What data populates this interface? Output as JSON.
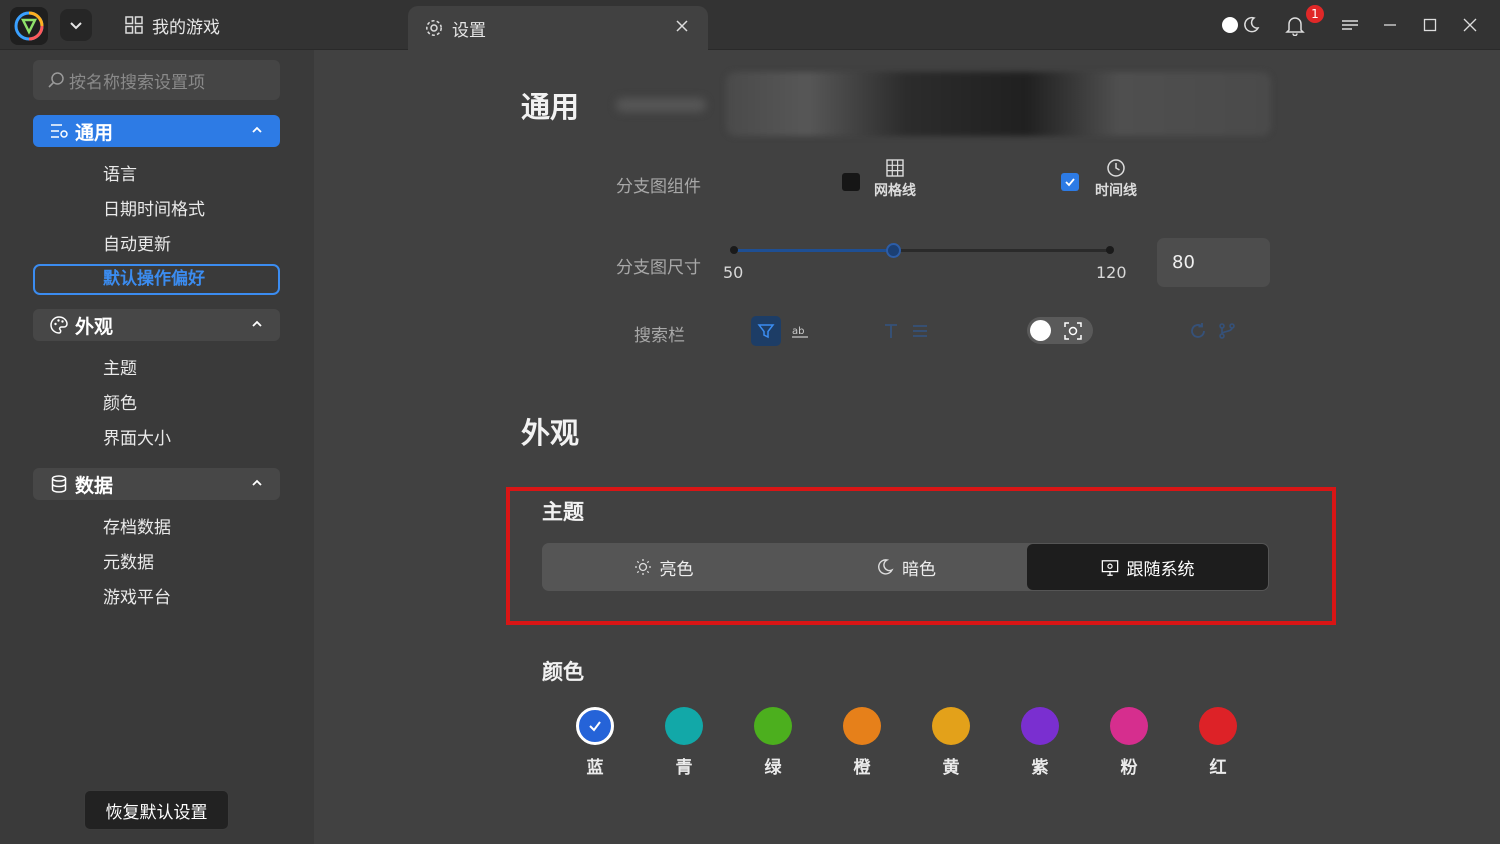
{
  "titlebar": {
    "tab_games": "我的游戏",
    "tab_settings": "设置",
    "notification_count": "1"
  },
  "sidebar": {
    "search_placeholder": "按名称搜索设置项",
    "groups": [
      {
        "label": "通用",
        "icon": "general-settings-icon",
        "items": [
          "语言",
          "日期时间格式",
          "自动更新",
          "默认操作偏好"
        ]
      },
      {
        "label": "外观",
        "icon": "palette-icon",
        "items": [
          "主题",
          "颜色",
          "界面大小"
        ]
      },
      {
        "label": "数据",
        "icon": "database-icon",
        "items": [
          "存档数据",
          "元数据",
          "游戏平台"
        ]
      }
    ],
    "restore_label": "恢复默认设置"
  },
  "main": {
    "general_title": "通用",
    "branch_widget_label": "分支图组件",
    "opt_grid": "网格线",
    "opt_timeline": "时间线",
    "branch_size_label": "分支图尺寸",
    "slider_min": "50",
    "slider_max": "120",
    "slider_value": "80",
    "search_bar_label": "搜索栏",
    "appearance_title": "外观",
    "theme_title": "主题",
    "theme_options": [
      "亮色",
      "暗色",
      "跟随系统"
    ],
    "theme_selected": "跟随系统",
    "color_title": "颜色",
    "colors": [
      {
        "label": "蓝",
        "hex": "#2563d8",
        "selected": true
      },
      {
        "label": "青",
        "hex": "#12a8a8",
        "selected": false
      },
      {
        "label": "绿",
        "hex": "#4caf1e",
        "selected": false
      },
      {
        "label": "橙",
        "hex": "#e6801a",
        "selected": false
      },
      {
        "label": "黄",
        "hex": "#e3a11a",
        "selected": false
      },
      {
        "label": "紫",
        "hex": "#7a2fd0",
        "selected": false
      },
      {
        "label": "粉",
        "hex": "#d62e8e",
        "selected": false
      },
      {
        "label": "红",
        "hex": "#dd2227",
        "selected": false
      }
    ]
  },
  "colors": {
    "accent": "#2d7be5",
    "highlight_box": "#d91515"
  }
}
